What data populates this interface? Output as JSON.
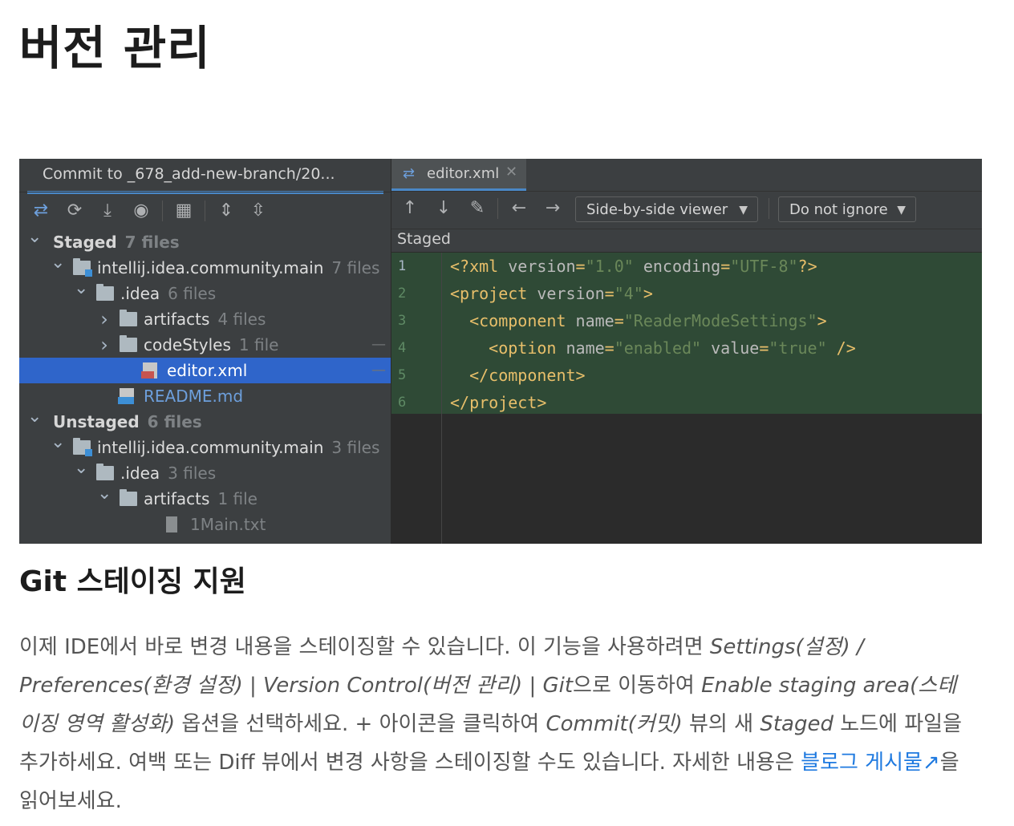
{
  "page": {
    "title": "버전 관리",
    "section_title": "Git 스테이징 지원",
    "paragraph": {
      "p1": "이제 IDE에서 바로 변경 내용을 스테이징할 수 있습니다. 이 기능을 사용하려면 ",
      "i1": "Settings(설정) / Preferences(환경 설정) | Version Control(버전 관리) | Git",
      "p2": "으로 이동하여 ",
      "i2": "Enable staging area(스테이징 영역 활성화)",
      "p3": " 옵션을 선택하세요. + 아이콘을 클릭하여 ",
      "i3": "Commit(커밋)",
      "p4": " 뷰의 새 ",
      "i4": "Staged",
      "p5": " 노드에 파일을 추가하세요. 여백 또는 Diff 뷰에서 변경 사항을 스테이징할 수도 있습니다. 자세한 내용은 ",
      "link": "블로그 게시물↗",
      "p6": "을 읽어보세요."
    }
  },
  "ide": {
    "commit_tab": "Commit to _678_add-new-branch/20...",
    "toolbar_icons": [
      "stage-icon",
      "refresh-icon",
      "download-icon",
      "eye-icon",
      "group-icon",
      "expand-all-icon",
      "collapse-all-icon"
    ],
    "tree": [
      {
        "label": "Staged",
        "count": "7 files",
        "arrow": "v",
        "indent": 0,
        "bold": true,
        "icon": "none"
      },
      {
        "label": "intellij.idea.community.main",
        "count": "7 files",
        "arrow": "v",
        "indent": 1,
        "icon": "module"
      },
      {
        "label": ".idea",
        "count": "6 files",
        "arrow": "v",
        "indent": 2,
        "icon": "folder"
      },
      {
        "label": "artifacts",
        "count": "4 files",
        "arrow": ">",
        "indent": 3,
        "icon": "folder"
      },
      {
        "label": "codeStyles",
        "count": "1 file",
        "arrow": ">",
        "indent": 3,
        "icon": "folder",
        "dash": true
      },
      {
        "label": "editor.xml",
        "count": "",
        "arrow": "",
        "indent": 4,
        "icon": "xml",
        "selected": true,
        "dash": true
      },
      {
        "label": "README.md",
        "count": "",
        "arrow": "",
        "indent": 3,
        "icon": "md",
        "blue": true
      },
      {
        "label": "Unstaged",
        "count": "6 files",
        "arrow": "v",
        "indent": 0,
        "bold": true,
        "icon": "none"
      },
      {
        "label": "intellij.idea.community.main",
        "count": "3 files",
        "arrow": "v",
        "indent": 1,
        "icon": "module"
      },
      {
        "label": ".idea",
        "count": "3 files",
        "arrow": "v",
        "indent": 2,
        "icon": "folder"
      },
      {
        "label": "artifacts",
        "count": "1 file",
        "arrow": "v",
        "indent": 3,
        "icon": "folder"
      },
      {
        "label": "1Main.txt",
        "count": "",
        "arrow": "",
        "indent": 5,
        "icon": "txt",
        "dim": true
      }
    ],
    "editor_tab": "editor.xml",
    "close_glyph": "✕",
    "diff_toolbar": {
      "viewer": "Side-by-side viewer",
      "ignore": "Do not ignore"
    },
    "staged_header": "Staged",
    "line_numbers": [
      "1",
      "2",
      "3",
      "4",
      "5",
      "6"
    ],
    "code": [
      [
        [
          "pi",
          "<?xml "
        ],
        [
          "attr",
          "version"
        ],
        [
          "pi",
          "="
        ],
        [
          "val",
          "\"1.0\""
        ],
        [
          "attr",
          " encoding"
        ],
        [
          "pi",
          "="
        ],
        [
          "val",
          "\"UTF-8\""
        ],
        [
          "pi",
          "?>"
        ]
      ],
      [
        [
          "tag",
          "<project "
        ],
        [
          "attr",
          "version"
        ],
        [
          "tag",
          "="
        ],
        [
          "val",
          "\"4\""
        ],
        [
          "tag",
          ">"
        ]
      ],
      [
        [
          "tag",
          "  <component "
        ],
        [
          "attr",
          "name"
        ],
        [
          "tag",
          "="
        ],
        [
          "val",
          "\"ReaderModeSettings\""
        ],
        [
          "tag",
          ">"
        ]
      ],
      [
        [
          "tag",
          "    <option "
        ],
        [
          "attr",
          "name"
        ],
        [
          "tag",
          "="
        ],
        [
          "val",
          "\"enabled\""
        ],
        [
          "attr",
          " value"
        ],
        [
          "tag",
          "="
        ],
        [
          "val",
          "\"true\""
        ],
        [
          "tag",
          " />"
        ]
      ],
      [
        [
          "tag",
          "  </component>"
        ]
      ],
      [
        [
          "tag",
          "</project>"
        ]
      ]
    ],
    "colors": {
      "accent": "#4a88c7",
      "selection": "#2f65ca",
      "staged_bg": "#2f4a36",
      "panel": "#3c3f41",
      "editor_bg": "#2b2b2b",
      "link": "#1f7ae0"
    }
  }
}
